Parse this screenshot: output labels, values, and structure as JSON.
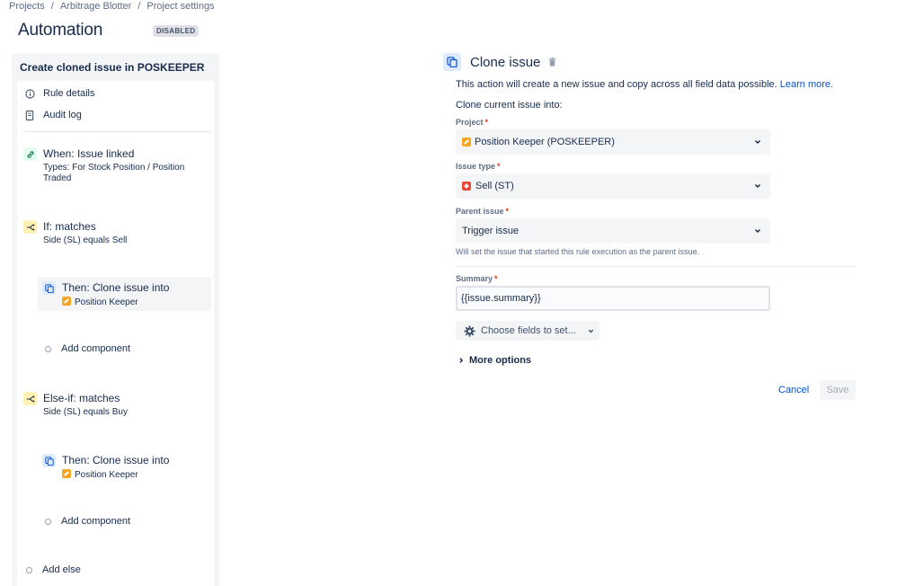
{
  "breadcrumb": [
    "Projects",
    "Arbitrage Blotter",
    "Project settings"
  ],
  "page": {
    "title": "Automation",
    "status": "DISABLED"
  },
  "rule": {
    "title": "Create cloned issue in POSKEEPER",
    "nav": [
      {
        "label": "Rule details",
        "icon": "info-icon"
      },
      {
        "label": "Audit log",
        "icon": "document-icon"
      }
    ],
    "trigger": {
      "label": "When: Issue linked",
      "desc": "Types: For Stock Position / Position Traded",
      "icon": "link-icon"
    },
    "condition_if": {
      "label": "If: matches",
      "desc": "Side (SL) equals Sell",
      "icon": "branch-icon"
    },
    "then_1": {
      "label": "Then: Clone issue into",
      "project": "Position Keeper",
      "icon": "clone-icon"
    },
    "add_component_1": "Add component",
    "condition_else_if": {
      "label": "Else-if: matches",
      "desc": "Side (SL) equals Buy",
      "icon": "branch-icon"
    },
    "then_2": {
      "label": "Then: Clone issue into",
      "project": "Position Keeper",
      "icon": "clone-icon"
    },
    "add_component_2": "Add component",
    "add_else": "Add else"
  },
  "action": {
    "title": "Clone issue",
    "intro": "This action will create a new issue and copy across all field data possible.",
    "learn_more": "Learn more.",
    "clone_into": "Clone current issue into:",
    "project": {
      "label": "Project",
      "value": "Position Keeper (POSKEEPER)"
    },
    "issue_type": {
      "label": "Issue type",
      "value": "Sell (ST)"
    },
    "parent_issue": {
      "label": "Parent issue",
      "value": "Trigger issue",
      "helper": "Will set the issue that started this rule execution as the parent issue."
    },
    "summary": {
      "label": "Summary",
      "value": "{{issue.summary}}"
    },
    "choose_fields": "Choose fields to set...",
    "more_options": "More options",
    "cancel": "Cancel",
    "save": "Save"
  },
  "colors": {
    "link": "#0052cc",
    "required": "#de350b",
    "project_icon": "#f5a623",
    "sell_icon": "#e5493a"
  }
}
